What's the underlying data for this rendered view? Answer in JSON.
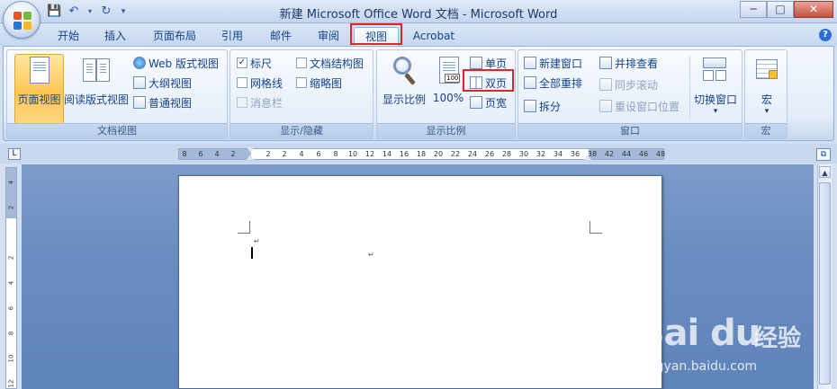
{
  "window": {
    "title": "新建 Microsoft Office Word 文档 - Microsoft Word",
    "minimize": "─",
    "maximize": "□",
    "close": "✕"
  },
  "quick_access": {
    "save_icon": "save-icon",
    "undo_icon": "undo-icon",
    "redo_icon": "redo-icon",
    "customize_icon": "customize-icon"
  },
  "tabs": [
    {
      "label": "开始"
    },
    {
      "label": "插入"
    },
    {
      "label": "页面布局"
    },
    {
      "label": "引用"
    },
    {
      "label": "邮件"
    },
    {
      "label": "审阅"
    },
    {
      "label": "视图",
      "active": true
    },
    {
      "label": "Acrobat"
    }
  ],
  "help": "?",
  "groups": {
    "doc_views": {
      "label": "文档视图",
      "print_layout": "页面视图",
      "full_screen_reading": "阅读版式视图",
      "web_layout": "Web 版式视图",
      "outline": "大纲视图",
      "draft": "普通视图"
    },
    "show_hide": {
      "label": "显示/隐藏",
      "ruler": "标尺",
      "gridlines": "网格线",
      "message_bar": "消息栏",
      "document_map": "文档结构图",
      "thumbnails": "缩略图",
      "ruler_checked": "✓"
    },
    "zoom": {
      "label": "显示比例",
      "zoom": "显示比例",
      "hundred": "100%",
      "one_page": "单页",
      "two_pages": "双页",
      "page_width": "页宽"
    },
    "window": {
      "label": "窗口",
      "new_window": "新建窗口",
      "arrange_all": "全部重排",
      "split": "拆分",
      "side_by_side": "并排查看",
      "sync_scroll": "同步滚动",
      "reset_position": "重设窗口位置",
      "switch_windows": "切换窗口",
      "switch_arrow": "▾"
    },
    "macros": {
      "label": "宏",
      "macros": "宏",
      "arrow": "▾"
    }
  },
  "ruler": {
    "corner": "L",
    "ticks": [
      "8",
      "6",
      "4",
      "2",
      "2",
      "2",
      "4",
      "6",
      "8",
      "10",
      "12",
      "14",
      "16",
      "18",
      "20",
      "22",
      "24",
      "26",
      "28",
      "30",
      "32",
      "34",
      "36",
      "38",
      "42",
      "44",
      "46",
      "48"
    ],
    "vticks": [
      "4",
      "2",
      "2",
      "4",
      "6",
      "8",
      "10",
      "12"
    ],
    "right_button": "⧉"
  },
  "scrollbar": {
    "up": "▲"
  },
  "watermark": {
    "brand": "Bai du",
    "cn": "经验",
    "url": "jingyan.baidu.com"
  }
}
